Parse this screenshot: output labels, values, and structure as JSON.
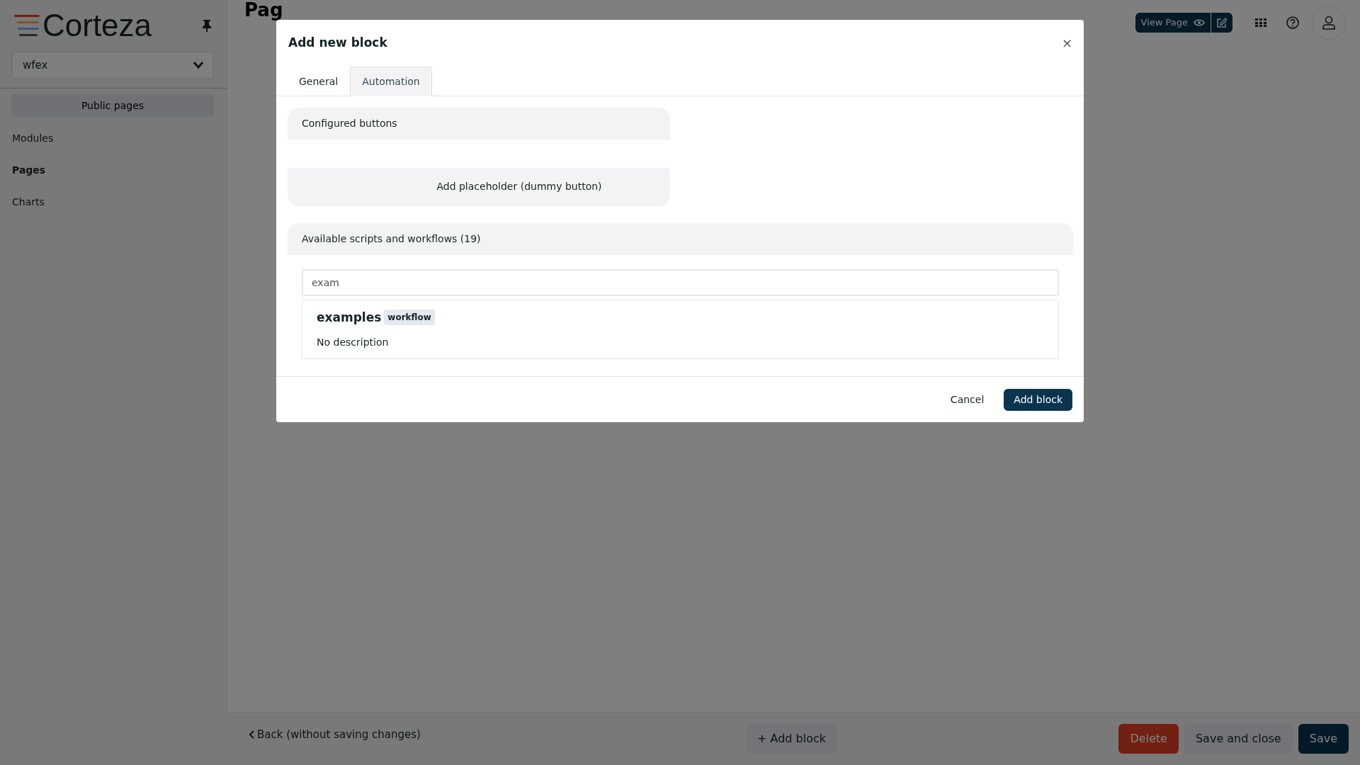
{
  "sidebar": {
    "logo": "Corteza",
    "namespace": "wfex",
    "section_button": "Public pages",
    "items": [
      {
        "label": "Modules",
        "selected": false
      },
      {
        "label": "Pages",
        "selected": true
      },
      {
        "label": "Charts",
        "selected": false
      }
    ]
  },
  "header": {
    "title": "Pag",
    "view_page_button": "View Page"
  },
  "modal": {
    "title": "Add new block",
    "close": "×",
    "tabs": [
      {
        "label": "General",
        "selected": false
      },
      {
        "label": "Automation",
        "selected": true
      }
    ],
    "configured_buttons": {
      "title": "Configured buttons",
      "add_button": "Add placeholder (dummy button)"
    },
    "available": {
      "title": "Available scripts and workflows (19)",
      "search": {
        "value": "exam"
      },
      "results": [
        {
          "name": "examples",
          "type": "workflow",
          "description": "No description"
        }
      ]
    },
    "cancel": "Cancel",
    "confirm": "Add block"
  },
  "footer": {
    "back": "Back (without saving changes)",
    "add_block": "+ Add block",
    "delete": "Delete",
    "save_and_close": "Save and close",
    "save": "Save"
  }
}
